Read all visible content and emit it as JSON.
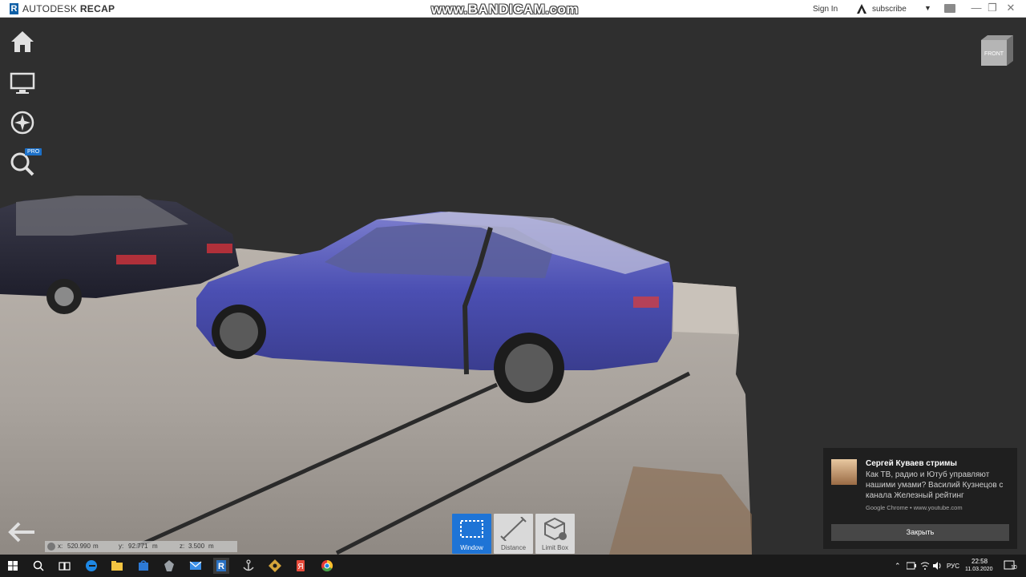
{
  "titlebar": {
    "logo_letter": "R",
    "app_name_1": "AUTODESK",
    "app_name_2": "RECAP",
    "watermark": "www.BANDICAM.com",
    "sign_in": "Sign In",
    "subscribe": "subscribe"
  },
  "viewcube": {
    "face": "FRONT"
  },
  "left_toolbar": {
    "pro_badge": "PRO",
    "items": [
      "home-icon",
      "display-icon",
      "navigation-compass-icon",
      "search-icon"
    ]
  },
  "coordinates": {
    "x_label": "x:",
    "x_value": "520.990",
    "x_unit": "m",
    "y_label": "y:",
    "y_value": "92.771",
    "y_unit": "m",
    "z_label": "z:",
    "z_value": "3.500",
    "z_unit": "m"
  },
  "bottom_tools": [
    {
      "label": "Window",
      "active": true
    },
    {
      "label": "Distance",
      "active": false
    },
    {
      "label": "Limit Box",
      "active": false
    }
  ],
  "notification": {
    "title": "Сергей Куваев стримы",
    "body": "Как ТВ, радио и Ютуб управляют нашими умами? Василий Кузнецов с канала Железный рейтинг",
    "source": "Google Chrome • www.youtube.com",
    "close_button": "Закрыть"
  },
  "taskbar": {
    "language": "РУС",
    "time": "22:58",
    "date": "11.03.2020",
    "notification_count": "10"
  },
  "colors": {
    "accent": "#1e74d6",
    "viewport_bg": "#2f2f2f",
    "car_blue": "#4a4fb0"
  }
}
